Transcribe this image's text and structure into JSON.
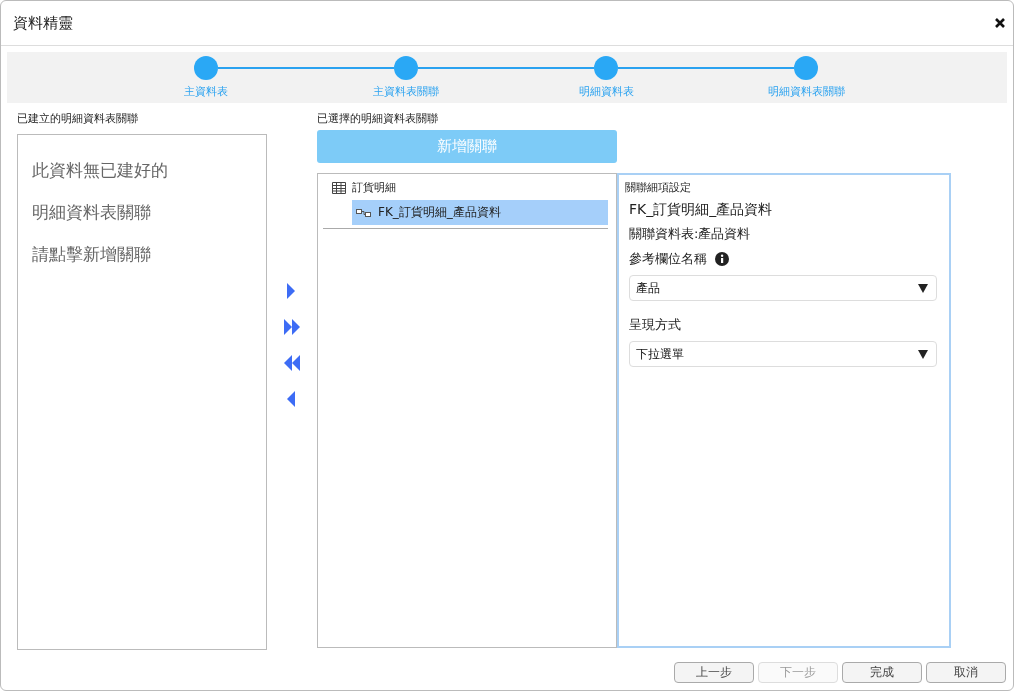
{
  "window": {
    "title": "資料精靈"
  },
  "steps": [
    {
      "label": "主資料表"
    },
    {
      "label": "主資料表關聯"
    },
    {
      "label": "明細資料表"
    },
    {
      "label": "明細資料表關聯"
    }
  ],
  "left_panel": {
    "title": "已建立的明細資料表關聯",
    "empty_lines": [
      "此資料無已建好的",
      "明細資料表關聯",
      "請點擊新增關聯"
    ]
  },
  "transfer_buttons": [
    {
      "kind": "move-one-right"
    },
    {
      "kind": "move-all-right"
    },
    {
      "kind": "move-all-left"
    },
    {
      "kind": "move-one-left"
    }
  ],
  "middle_panel": {
    "title": "已選擇的明細資料表關聯",
    "add_button": "新增關聯",
    "tree": [
      {
        "label": "訂貨明細",
        "children": [
          {
            "label": "FK_訂貨明細_產品資料",
            "selected": true
          }
        ]
      }
    ]
  },
  "settings": {
    "title": "關聯細項設定",
    "name": "FK_訂貨明細_產品資料",
    "related_table": "關聯資料表:產品資料",
    "fields": [
      {
        "label": "參考欄位名稱",
        "info": true,
        "value": "產品"
      },
      {
        "label": "呈現方式",
        "info": false,
        "value": "下拉選單"
      }
    ]
  },
  "footer_buttons": [
    {
      "label": "上一步",
      "disabled": false
    },
    {
      "label": "下一步",
      "disabled": true
    },
    {
      "label": "完成",
      "disabled": false
    },
    {
      "label": "取消",
      "disabled": false
    }
  ]
}
